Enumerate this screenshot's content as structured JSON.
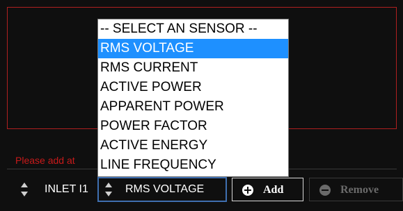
{
  "warning_text": "Please add at",
  "inlet_select": {
    "value": "INLET I1",
    "icon": "sort-arrows-icon"
  },
  "sensor_select": {
    "value": "RMS VOLTAGE",
    "icon": "sort-arrows-icon",
    "options": [
      "-- SELECT AN SENSOR --",
      "RMS VOLTAGE",
      "RMS CURRENT",
      "ACTIVE POWER",
      "APPARENT POWER",
      "POWER FACTOR",
      "ACTIVE ENERGY",
      "LINE FREQUENCY"
    ],
    "highlighted_index": 1
  },
  "buttons": {
    "add": {
      "label": "Add",
      "icon": "plus-circle-icon"
    },
    "remove": {
      "label": "Remove",
      "icon": "minus-circle-icon",
      "disabled": true
    }
  },
  "colors": {
    "background": "#0f0f0f",
    "panel_border": "#b02020",
    "warning": "#c81a1a",
    "highlight": "#1e90ff",
    "focus_border": "#3f6fb0"
  }
}
